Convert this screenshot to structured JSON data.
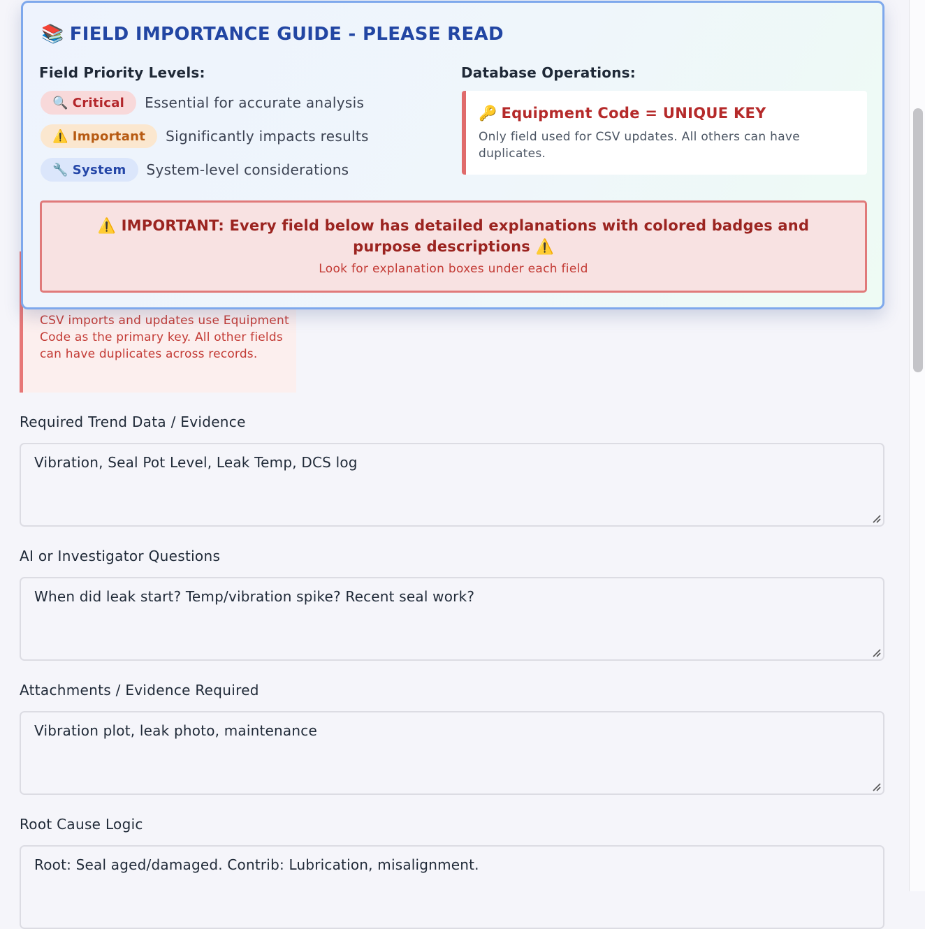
{
  "guide": {
    "title": "FIELD IMPORTANCE GUIDE - PLEASE READ",
    "title_icon": "📚",
    "priority_heading": "Field Priority Levels:",
    "priority_levels": [
      {
        "icon": "🔍",
        "badge": "Critical",
        "description": "Essential for accurate analysis"
      },
      {
        "icon": "⚠️",
        "badge": "Important",
        "description": "Significantly impacts results"
      },
      {
        "icon": "🔧",
        "badge": "System",
        "description": "System-level considerations"
      }
    ],
    "db_heading": "Database Operations:",
    "unique_key": {
      "icon": "🔑",
      "title": "Equipment Code = UNIQUE KEY",
      "description": "Only field used for CSV updates. All others can have duplicates."
    },
    "alert": {
      "main": "⚠️ IMPORTANT: Every field below has detailed explanations with colored badges and purpose descriptions ⚠️",
      "sub": "Look for explanation boxes under each field"
    }
  },
  "background_note": {
    "text": "CSV imports and updates use Equipment Code as the primary key. All other fields can have duplicates across records."
  },
  "fields": [
    {
      "label": "Required Trend Data / Evidence",
      "value": "Vibration, Seal Pot Level, Leak Temp, DCS log"
    },
    {
      "label": "AI or Investigator Questions",
      "value": "When did leak start? Temp/vibration spike? Recent seal work?"
    },
    {
      "label": "Attachments / Evidence Required",
      "value": "Vibration plot, leak photo, maintenance"
    },
    {
      "label": "Root Cause Logic",
      "value": "Root: Seal aged/damaged. Contrib: Lubrication, misalignment."
    }
  ],
  "colors": {
    "accent_blue": "#2246a3",
    "critical": "#b3262b",
    "important": "#b75a12",
    "system": "#2547a8",
    "alert_border": "#e07a7a"
  }
}
